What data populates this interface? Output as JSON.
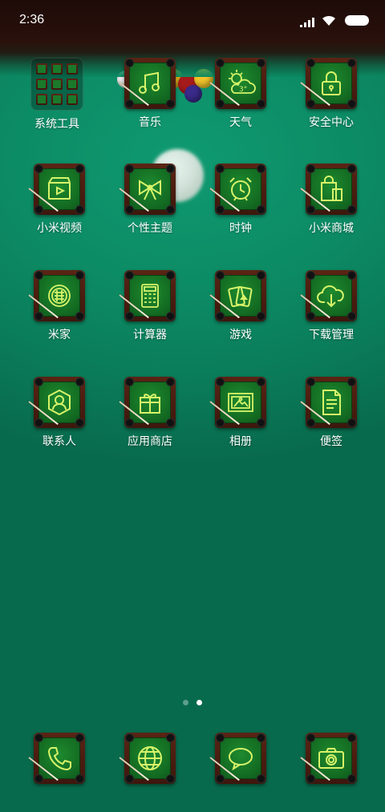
{
  "status_bar": {
    "time": "2:36",
    "icons": [
      "signal-icon",
      "wifi-icon",
      "battery-icon"
    ]
  },
  "home": {
    "rows": [
      [
        {
          "label": "系统工具",
          "icon": "folder-icon"
        },
        {
          "label": "音乐",
          "icon": "music-note-icon"
        },
        {
          "label": "天气",
          "icon": "weather-cloud-sun-icon",
          "temp": "3°"
        },
        {
          "label": "安全中心",
          "icon": "lock-icon"
        }
      ],
      [
        {
          "label": "小米视频",
          "icon": "video-clapper-icon"
        },
        {
          "label": "个性主题",
          "icon": "bow-icon"
        },
        {
          "label": "时钟",
          "icon": "alarm-clock-icon"
        },
        {
          "label": "小米商城",
          "icon": "shopping-bag-icon"
        }
      ],
      [
        {
          "label": "米家",
          "icon": "smart-home-icon"
        },
        {
          "label": "计算器",
          "icon": "calculator-icon"
        },
        {
          "label": "游戏",
          "icon": "playing-cards-icon"
        },
        {
          "label": "下载管理",
          "icon": "cloud-download-icon"
        }
      ],
      [
        {
          "label": "联系人",
          "icon": "contact-person-icon"
        },
        {
          "label": "应用商店",
          "icon": "gift-box-icon"
        },
        {
          "label": "相册",
          "icon": "photo-frame-icon"
        },
        {
          "label": "便签",
          "icon": "notes-icon"
        }
      ]
    ]
  },
  "page_indicator": {
    "count": 2,
    "active": 1
  },
  "dock": [
    {
      "icon": "phone-icon"
    },
    {
      "icon": "globe-browser-icon"
    },
    {
      "icon": "message-bubble-icon"
    },
    {
      "icon": "camera-icon"
    }
  ],
  "colors": {
    "accent": "#d7f36a",
    "felt": "#136b22",
    "frame": "#4a1d10",
    "background": "#0b8a62"
  }
}
